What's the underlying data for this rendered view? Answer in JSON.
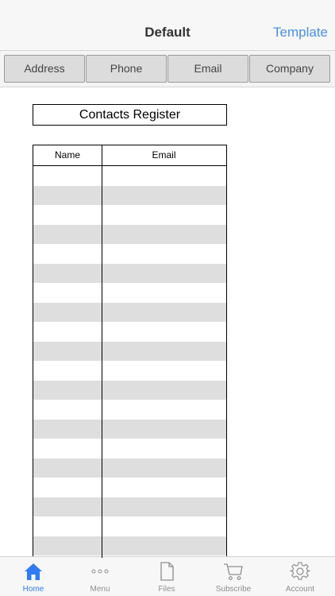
{
  "navbar": {
    "title": "Default",
    "right_action": "Template"
  },
  "segments": [
    "Address",
    "Phone",
    "Email",
    "Company"
  ],
  "sheet": {
    "title": "Contacts Register",
    "columns": [
      "Name",
      "Email"
    ],
    "row_count": 20
  },
  "tabbar": {
    "items": [
      {
        "label": "Home",
        "icon": "home-icon",
        "active": true
      },
      {
        "label": "Menu",
        "icon": "more-dots-icon",
        "active": false
      },
      {
        "label": "Files",
        "icon": "document-icon",
        "active": false
      },
      {
        "label": "Subscribe",
        "icon": "cart-icon",
        "active": false
      },
      {
        "label": "Account",
        "icon": "gear-icon",
        "active": false
      }
    ]
  },
  "colors": {
    "accent": "#2f7cf6",
    "link": "#4a90e2",
    "row_shade": "#dedede"
  }
}
